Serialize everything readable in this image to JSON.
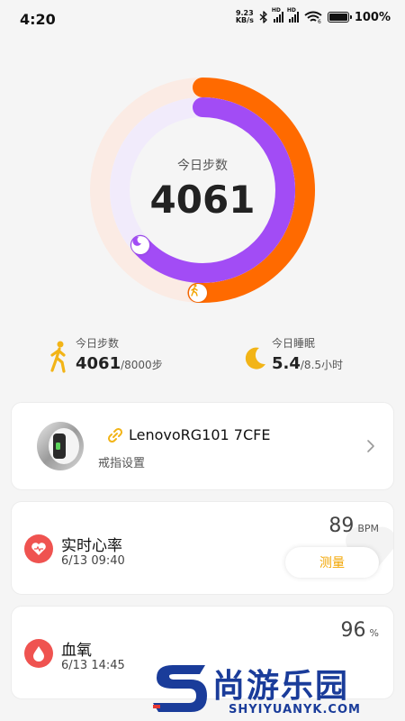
{
  "status_bar": {
    "time": "4:20",
    "net_speed_value": "9.23",
    "net_speed_unit": "KB/s",
    "hd1": "HD",
    "hd2": "HD",
    "wifi_badge": "6",
    "battery": "100%",
    "battery_level": 1.0
  },
  "ring": {
    "label": "今日步数",
    "value": "4061",
    "steps_progress": 0.5076,
    "sleep_progress": 0.635,
    "colors": {
      "steps": "#ff6a00",
      "steps_track": "#fbebe4",
      "sleep": "#a24cf5",
      "sleep_track": "#f1ebfb"
    }
  },
  "summary": {
    "steps": {
      "label": "今日步数",
      "value": "4061",
      "goal": "/8000步",
      "icon": "walking-icon",
      "color": "#f2b417"
    },
    "sleep": {
      "label": "今日睡眠",
      "value": "5.4",
      "goal": "/8.5小时",
      "icon": "moon-icon",
      "color": "#f2b417"
    }
  },
  "device": {
    "name": "LenovoRG101 7CFE",
    "settings_label": "戒指设置",
    "link_icon": "link-icon",
    "chevron_icon": "chevron-right-icon"
  },
  "heart_rate": {
    "title": "实时心率",
    "time": "6/13 09:40",
    "value": "89",
    "unit": "BPM",
    "button": "测量",
    "icon": "heart-rate-icon",
    "color": "#ef5350"
  },
  "blood_oxygen": {
    "title": "血氧",
    "time": "6/13 14:45",
    "value": "96",
    "unit": "%",
    "icon": "blood-drop-icon",
    "color": "#ef5350"
  },
  "watermark": {
    "text": "尚游乐园",
    "sub": "SHYIYUANYK.COM"
  }
}
